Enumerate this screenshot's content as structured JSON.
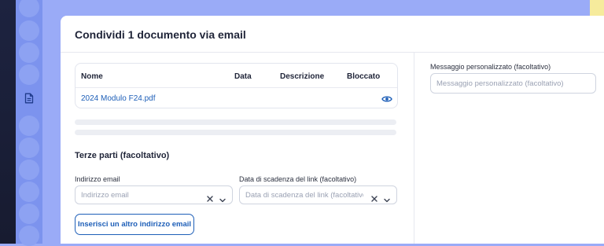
{
  "dialog": {
    "title": "Condividi 1 documento via email"
  },
  "documents_table": {
    "columns": [
      "Nome",
      "Data",
      "Descrizione",
      "Bloccato"
    ],
    "rows": [
      {
        "name": "2024 Modulo F24.pdf",
        "date": "",
        "description": "",
        "locked": ""
      }
    ],
    "row_action_icon": "eye-icon"
  },
  "third_parties": {
    "title": "Terze parti (facoltativo)",
    "email": {
      "label": "Indirizzo email",
      "placeholder": "Indirizzo email",
      "value": ""
    },
    "expiry": {
      "label": "Data di scadenza del link (facoltativo)",
      "placeholder": "Data di scadenza del link (facoltativo)",
      "value": ""
    },
    "add_email_label": "Inserisci un altro indirizzo email"
  },
  "message": {
    "label": "Messaggio personalizzato (facoltativo)",
    "placeholder": "Messaggio personalizzato (facoltativo)",
    "value": ""
  },
  "icons": {
    "sidebar_active": "document-icon",
    "clear": "close-icon",
    "dropdown": "chevron-down-icon"
  },
  "colors": {
    "accent": "#1e5fb8",
    "background": "#9aabf7",
    "sidebar": "#7c93ee",
    "text": "#1f2438"
  }
}
